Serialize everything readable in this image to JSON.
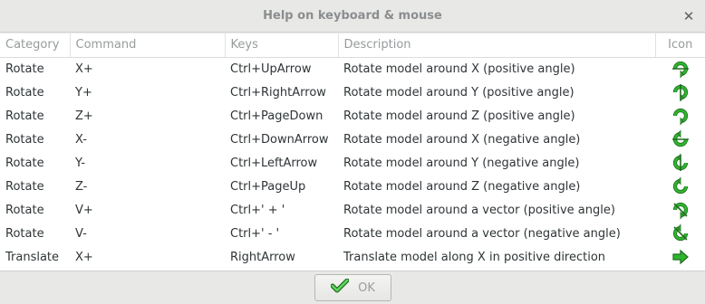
{
  "window": {
    "title": "Help on keyboard & mouse"
  },
  "table": {
    "headers": [
      "Category",
      "Command",
      "Keys",
      "Description",
      "Icon"
    ],
    "rows": [
      {
        "category": "Rotate",
        "command": "X+",
        "keys": "Ctrl+UpArrow",
        "description": "Rotate model around X (positive angle)",
        "icon": "rotate-x-positive-icon"
      },
      {
        "category": "Rotate",
        "command": "Y+",
        "keys": "Ctrl+RightArrow",
        "description": "Rotate model around Y (positive angle)",
        "icon": "rotate-y-positive-icon"
      },
      {
        "category": "Rotate",
        "command": "Z+",
        "keys": "Ctrl+PageDown",
        "description": "Rotate model around Z (positive angle)",
        "icon": "rotate-z-positive-icon"
      },
      {
        "category": "Rotate",
        "command": "X-",
        "keys": "Ctrl+DownArrow",
        "description": "Rotate model around X (negative angle)",
        "icon": "rotate-x-negative-icon"
      },
      {
        "category": "Rotate",
        "command": "Y-",
        "keys": "Ctrl+LeftArrow",
        "description": "Rotate model around Y (negative angle)",
        "icon": "rotate-y-negative-icon"
      },
      {
        "category": "Rotate",
        "command": "Z-",
        "keys": "Ctrl+PageUp",
        "description": "Rotate model around Z (negative angle)",
        "icon": "rotate-z-negative-icon"
      },
      {
        "category": "Rotate",
        "command": "V+",
        "keys": "Ctrl+' + '",
        "description": "Rotate model around a vector (positive angle)",
        "icon": "rotate-vector-positive-icon"
      },
      {
        "category": "Rotate",
        "command": "V-",
        "keys": "Ctrl+' - '",
        "description": "Rotate model around a vector (negative angle)",
        "icon": "rotate-vector-negative-icon"
      },
      {
        "category": "Translate",
        "command": "X+",
        "keys": "RightArrow",
        "description": "Translate model along X in positive direction",
        "icon": "translate-x-positive-icon"
      }
    ]
  },
  "footer": {
    "ok_label": "OK",
    "ok_icon": "check-icon"
  },
  "colors": {
    "icon_green": "#2fb52f",
    "icon_dark": "#1e6e1e"
  }
}
